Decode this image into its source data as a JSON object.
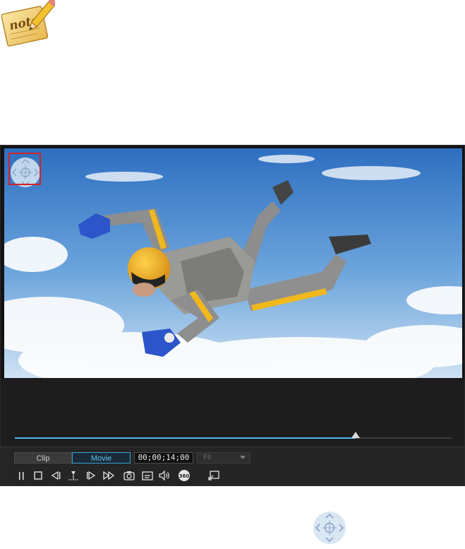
{
  "note": {
    "text": "note"
  },
  "player": {
    "view_mode": {
      "clip_label": "Clip",
      "movie_label": "Movie",
      "selected": "Movie"
    },
    "timecode": "00;00;14;00",
    "zoom": {
      "selected": "Fit"
    },
    "scrub": {
      "position_fraction": 0.78
    },
    "controls": [
      {
        "name": "pause-icon"
      },
      {
        "name": "stop-icon"
      },
      {
        "name": "previous-frame-icon"
      },
      {
        "name": "split-icon"
      },
      {
        "name": "next-frame-icon"
      },
      {
        "name": "fast-forward-icon"
      },
      {
        "name": "snapshot-icon"
      },
      {
        "name": "subtitle-icon"
      },
      {
        "name": "volume-icon"
      },
      {
        "name": "360-view-icon"
      },
      {
        "name": "undock-icon"
      }
    ],
    "colors": {
      "accent": "#4fb7e8",
      "highlight": "#d2232a",
      "background": "#141414"
    }
  }
}
